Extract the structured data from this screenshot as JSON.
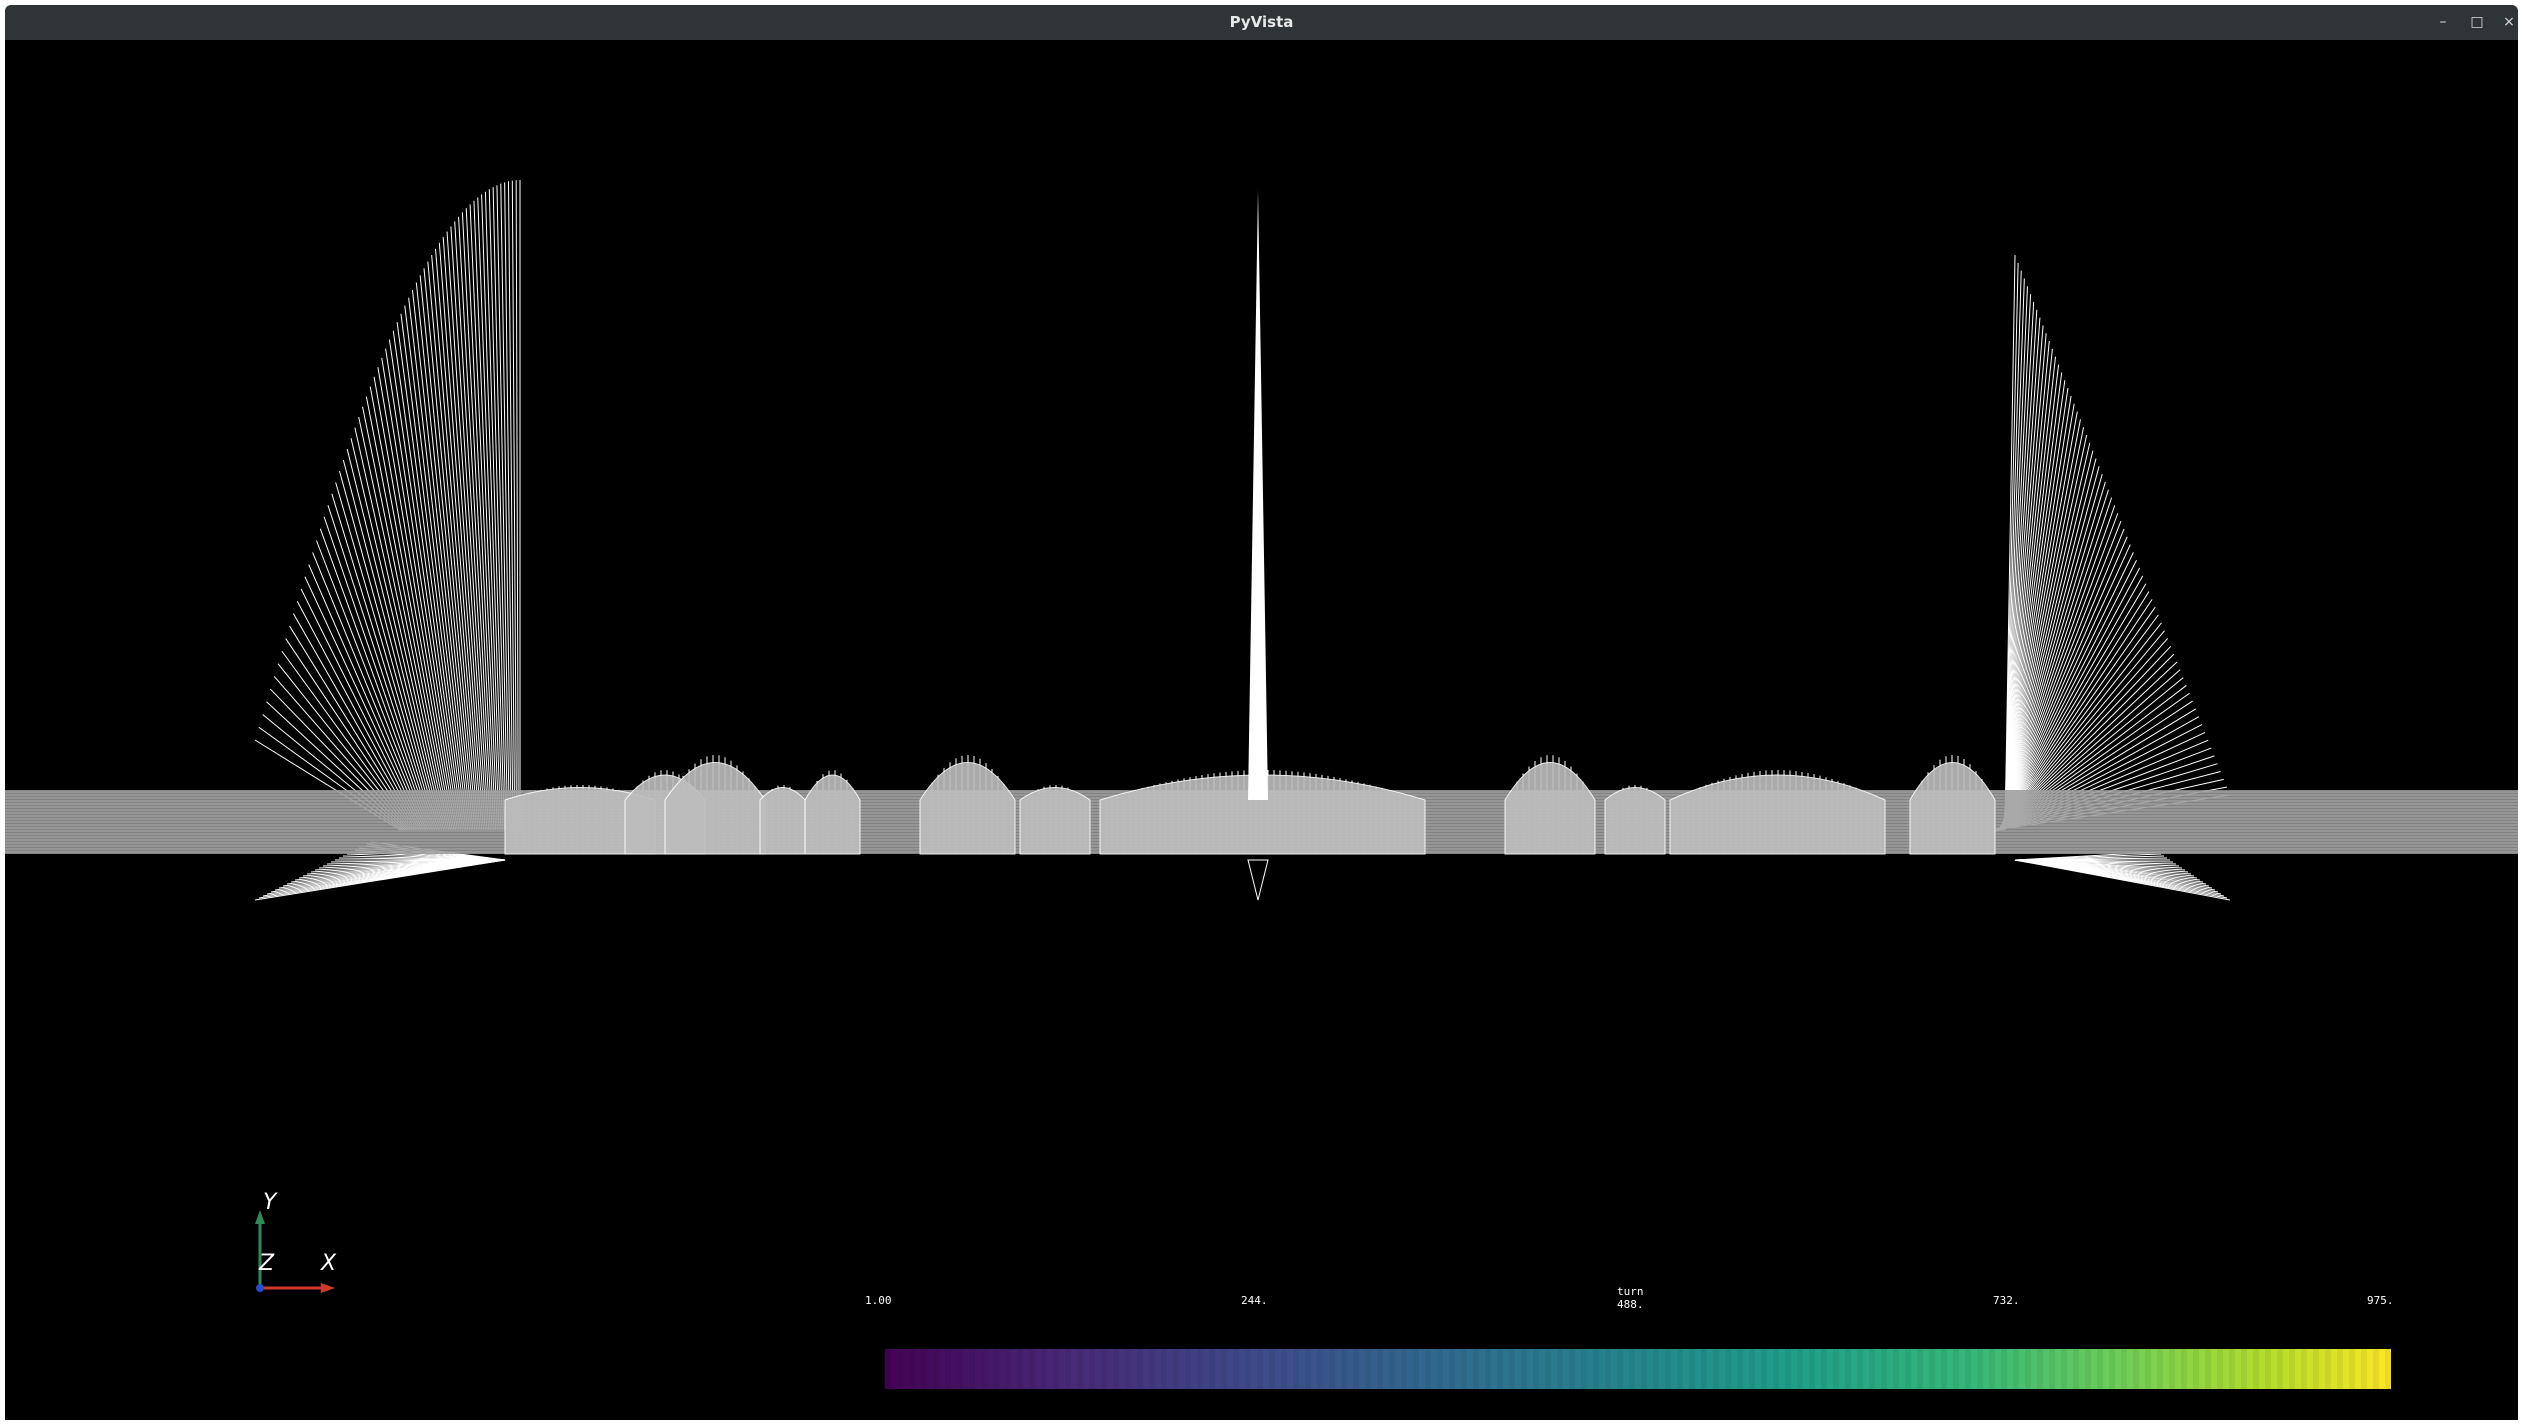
{
  "window": {
    "title": "PyVista",
    "controls": {
      "minimize": "–",
      "maximize": "□",
      "close": "×"
    }
  },
  "axes_widget": {
    "y": "Y",
    "z": "Z",
    "x": "X"
  },
  "scalar_bar": {
    "title": "turn",
    "colormap": "viridis",
    "tick_labels": [
      "1.00",
      "244.",
      "488.",
      "732.",
      "975."
    ]
  },
  "colors": {
    "background": "#000000",
    "mesh": "#ffffff",
    "titlebar": "#2f3436",
    "axis_x": "#d03a2b",
    "axis_y": "#2e8b57",
    "axis_z": "#2b4bd0"
  }
}
